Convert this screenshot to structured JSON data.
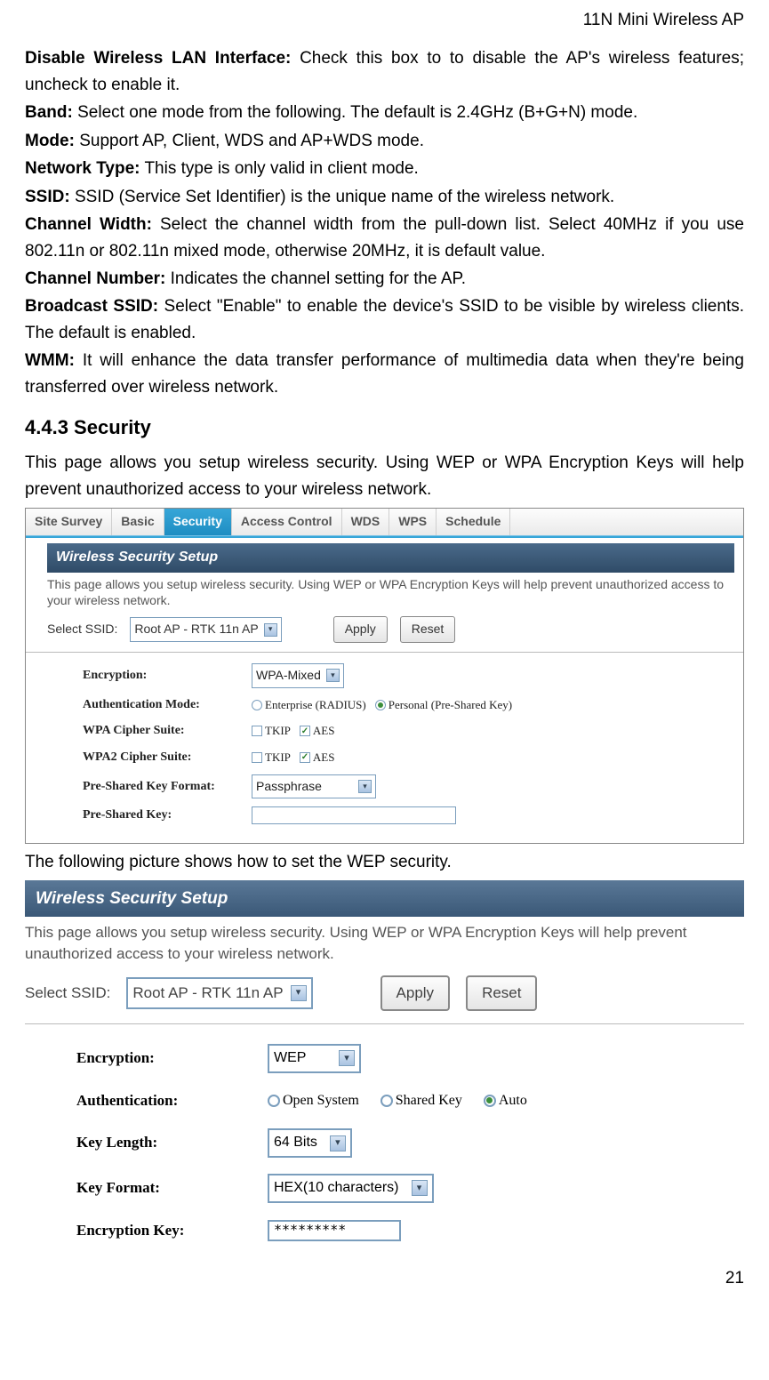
{
  "header": "11N Mini Wireless AP",
  "defs": [
    {
      "term": "Disable Wireless LAN Interface:",
      "text": " Check this box to to disable the AP's wireless features; uncheck to enable it."
    },
    {
      "term": "Band:",
      "text": " Select one mode from the following. The default is 2.4GHz (B+G+N) mode."
    },
    {
      "term": "Mode:",
      "text": " Support AP, Client, WDS and AP+WDS mode."
    },
    {
      "term": "Network Type:",
      "text": " This type is only valid in client mode."
    },
    {
      "term": "SSID:",
      "text": " SSID (Service Set Identifier) is the unique name of the wireless network."
    },
    {
      "term": "Channel Width:",
      "text": " Select the channel width from the pull-down list. Select 40MHz if you use 802.11n or 802.11n mixed mode, otherwise 20MHz, it is default value."
    },
    {
      "term": "Channel Number:",
      "text": " Indicates the channel setting for the AP."
    },
    {
      "term": "Broadcast SSID:",
      "text": " Select \"Enable\" to enable the device's SSID to be visible by wireless clients. The default is enabled."
    },
    {
      "term": "WMM:",
      "text": " It will enhance the data transfer performance of multimedia data when they're being transferred over wireless network."
    }
  ],
  "section_heading": "4.4.3 Security",
  "section_intro": "This page allows you setup wireless security. Using WEP or WPA Encryption Keys will help prevent unauthorized access to your wireless network.",
  "shot1": {
    "tabs": [
      "Site Survey",
      "Basic",
      "Security",
      "Access Control",
      "WDS",
      "WPS",
      "Schedule"
    ],
    "active_tab_index": 2,
    "panel_title": "Wireless Security Setup",
    "panel_desc": "This page allows you setup wireless security. Using WEP or WPA Encryption Keys will help prevent unauthorized access to your wireless network.",
    "select_ssid_label": "Select SSID:",
    "select_ssid_value": "Root AP - RTK 11n AP",
    "apply_label": "Apply",
    "reset_label": "Reset",
    "rows": {
      "encryption_label": "Encryption:",
      "encryption_value": "WPA-Mixed",
      "auth_label": "Authentication Mode:",
      "auth_opt1": "Enterprise (RADIUS)",
      "auth_opt2": "Personal (Pre-Shared Key)",
      "wpa_label": "WPA Cipher Suite:",
      "wpa2_label": "WPA2 Cipher Suite:",
      "tkip": "TKIP",
      "aes": "AES",
      "pskfmt_label": "Pre-Shared Key Format:",
      "pskfmt_value": "Passphrase",
      "psk_label": "Pre-Shared Key:"
    }
  },
  "mid_text": "The following picture shows how to set the WEP security.",
  "shot2": {
    "panel_title": "Wireless Security Setup",
    "panel_desc": "This page allows you setup wireless security. Using WEP or WPA Encryption Keys will help prevent unauthorized access to your wireless network.",
    "select_ssid_label": "Select SSID:",
    "select_ssid_value": "Root AP - RTK 11n AP",
    "apply_label": "Apply",
    "reset_label": "Reset",
    "rows": {
      "encryption_label": "Encryption:",
      "encryption_value": "WEP",
      "auth_label": "Authentication:",
      "auth_opt1": "Open System",
      "auth_opt2": "Shared Key",
      "auth_opt3": "Auto",
      "keylen_label": "Key Length:",
      "keylen_value": "64 Bits",
      "keyfmt_label": "Key Format:",
      "keyfmt_value": "HEX(10 characters)",
      "enckey_label": "Encryption Key:",
      "enckey_value": "*********"
    }
  },
  "page_number": "21"
}
